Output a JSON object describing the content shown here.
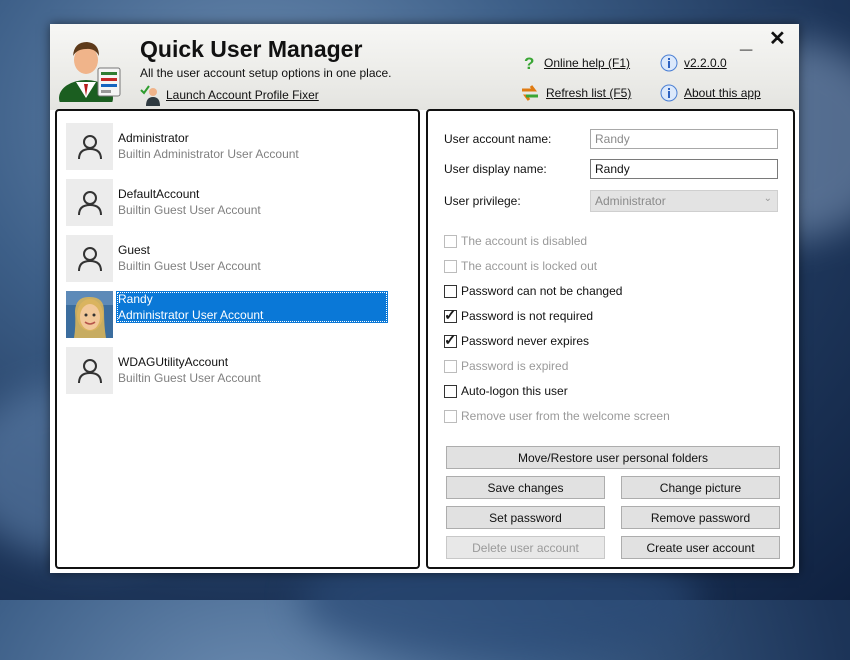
{
  "app": {
    "title": "Quick User Manager",
    "subtitle": "All the user account setup options in one place.",
    "fixer_link": "Launch Account Profile Fixer",
    "online_help": "Online help (F1)",
    "version": "v2.2.0.0",
    "refresh": "Refresh list (F5)",
    "about": "About this app"
  },
  "window_controls": {
    "minimize": "_",
    "close": "✕"
  },
  "users": [
    {
      "name": "Administrator",
      "desc": "Builtin Administrator User Account",
      "selected": false,
      "avatar_icon": "user-outline-icon"
    },
    {
      "name": "DefaultAccount",
      "desc": "Builtin Guest User Account",
      "selected": false,
      "avatar_icon": "user-outline-icon"
    },
    {
      "name": "Guest",
      "desc": "Builtin Guest User Account",
      "selected": false,
      "avatar_icon": "user-outline-icon"
    },
    {
      "name": "Randy",
      "desc": "Administrator User Account",
      "selected": true,
      "avatar_icon": "user-photo"
    },
    {
      "name": "WDAGUtilityAccount",
      "desc": "Builtin Guest User Account",
      "selected": false,
      "avatar_icon": "user-outline-icon"
    }
  ],
  "details": {
    "account_name_label": "User account name:",
    "account_name_value": "Randy",
    "display_name_label": "User display name:",
    "display_name_value": "Randy",
    "privilege_label": "User privilege:",
    "privilege_value": "Administrator"
  },
  "checkboxes": [
    {
      "label": "The account is disabled",
      "checked": false,
      "enabled": false
    },
    {
      "label": "The account is locked out",
      "checked": false,
      "enabled": false
    },
    {
      "label": "Password can not be changed",
      "checked": false,
      "enabled": true
    },
    {
      "label": "Password is not required",
      "checked": true,
      "enabled": true
    },
    {
      "label": "Password never expires",
      "checked": true,
      "enabled": true
    },
    {
      "label": "Password is expired",
      "checked": false,
      "enabled": false
    },
    {
      "label": "Auto-logon this user",
      "checked": false,
      "enabled": true
    },
    {
      "label": "Remove user from the welcome screen",
      "checked": false,
      "enabled": false
    }
  ],
  "buttons": {
    "move_restore": "Move/Restore user personal folders",
    "save_changes": "Save changes",
    "change_picture": "Change picture",
    "set_password": "Set password",
    "remove_password": "Remove password",
    "delete_user": "Delete user account",
    "create_user": "Create user account"
  },
  "colors": {
    "selection": "#0a78d7",
    "header_bg": "#ececea",
    "disabled_text": "#9a9a9a"
  }
}
